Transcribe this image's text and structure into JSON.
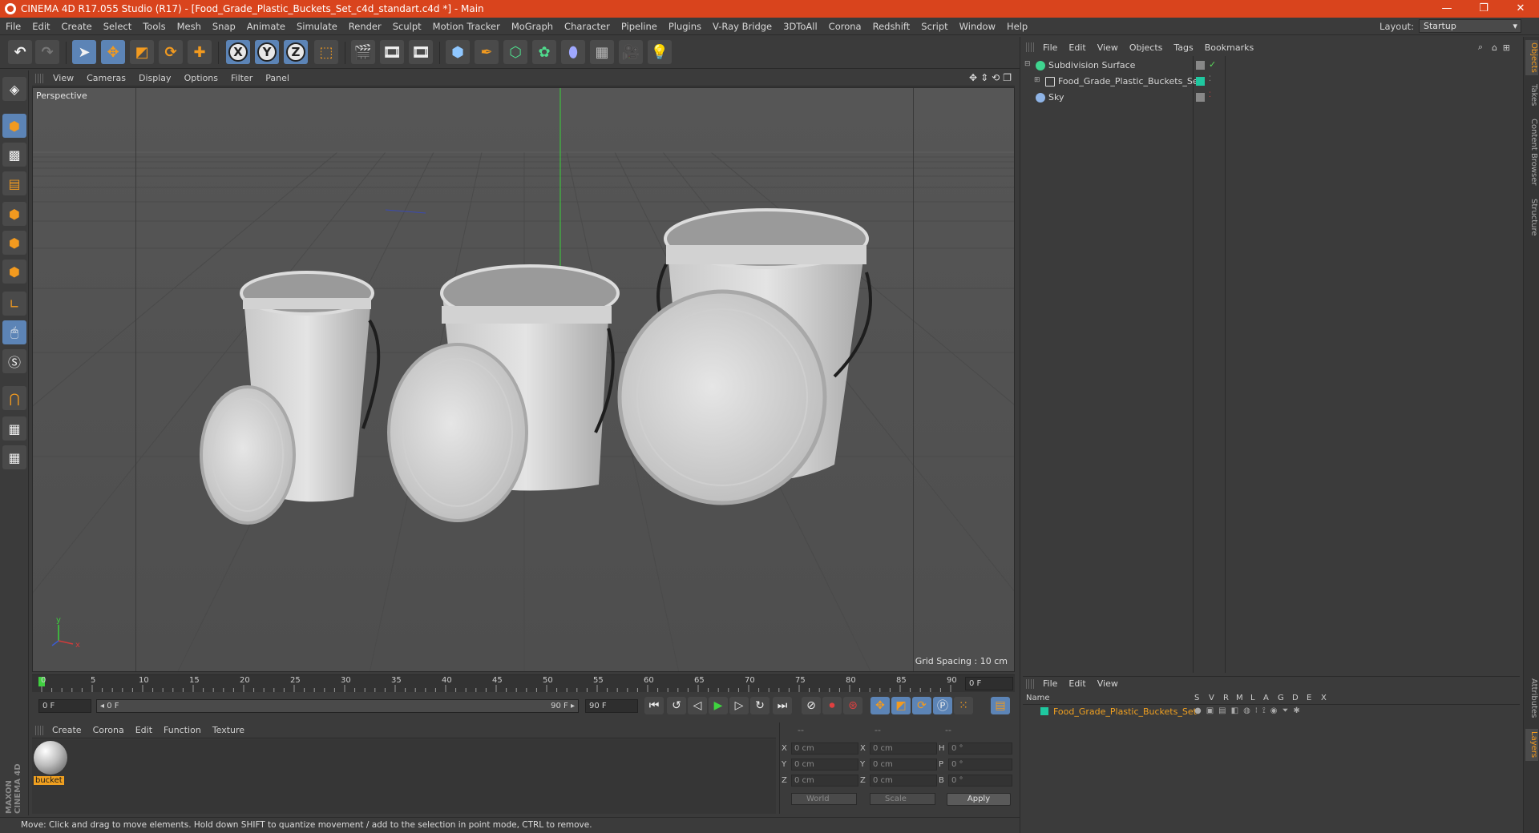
{
  "window": {
    "title": "CINEMA 4D R17.055 Studio (R17) - [Food_Grade_Plastic_Buckets_Set_c4d_standart.c4d *] - Main",
    "controls": [
      "—",
      "❐",
      "✕"
    ]
  },
  "menu": [
    "File",
    "Edit",
    "Create",
    "Select",
    "Tools",
    "Mesh",
    "Snap",
    "Animate",
    "Simulate",
    "Render",
    "Sculpt",
    "Motion Tracker",
    "MoGraph",
    "Character",
    "Pipeline",
    "Plugins",
    "V-Ray Bridge",
    "3DToAll",
    "Corona",
    "Redshift",
    "Script",
    "Window",
    "Help"
  ],
  "layout": {
    "label": "Layout:",
    "value": "Startup"
  },
  "toolbar": {
    "axis_x": "X",
    "axis_y": "Y",
    "axis_z": "Z"
  },
  "viewport": {
    "menu": [
      "View",
      "Cameras",
      "Display",
      "Options",
      "Filter",
      "Panel"
    ],
    "label": "Perspective",
    "grid_spacing": "Grid Spacing : 10 cm",
    "axis_y": "y",
    "axis_x": "x"
  },
  "timeline": {
    "ticks": [
      "0",
      "5",
      "10",
      "15",
      "20",
      "25",
      "30",
      "35",
      "40",
      "45",
      "50",
      "55",
      "60",
      "65",
      "70",
      "75",
      "80",
      "85",
      "90"
    ],
    "current_frame": "0 F",
    "start_frame": "0 F",
    "range_start": "◂ 0 F",
    "range_end": "90 F ▸",
    "end_frame": "90 F"
  },
  "material_manager": {
    "menu": [
      "Create",
      "Corona",
      "Edit",
      "Function",
      "Texture"
    ],
    "material_name": "bucket"
  },
  "coordinates": {
    "headers": [
      "--",
      "--",
      "--"
    ],
    "rows": [
      {
        "l1": "X",
        "v1": "0 cm",
        "l2": "X",
        "v2": "0 cm",
        "l3": "H",
        "v3": "0 °"
      },
      {
        "l1": "Y",
        "v1": "0 cm",
        "l2": "Y",
        "v2": "0 cm",
        "l3": "P",
        "v3": "0 °"
      },
      {
        "l1": "Z",
        "v1": "0 cm",
        "l2": "Z",
        "v2": "0 cm",
        "l3": "B",
        "v3": "0 °"
      }
    ],
    "mode": "World",
    "scale_mode": "Scale",
    "apply": "Apply"
  },
  "object_manager": {
    "menu": [
      "File",
      "Edit",
      "View",
      "Objects",
      "Tags",
      "Bookmarks"
    ],
    "objects": [
      {
        "name": "Subdivision Surface",
        "icon_color": "#3fd48f"
      },
      {
        "name": "Food_Grade_Plastic_Buckets_Set",
        "icon_color": "#cfcfcf",
        "tag_color": "#1fc8a0"
      },
      {
        "name": "Sky",
        "icon_color": "#8fb4e6"
      }
    ]
  },
  "layer_manager": {
    "menu": [
      "File",
      "Edit",
      "View"
    ],
    "columns": [
      "Name",
      "S",
      "V",
      "R",
      "M",
      "L",
      "A",
      "G",
      "D",
      "E",
      "X"
    ],
    "layers": [
      {
        "name": "Food_Grade_Plastic_Buckets_Set",
        "color": "#1fc8a0"
      }
    ]
  },
  "side_tabs": [
    "Objects",
    "Takes",
    "Content Browser",
    "Structure"
  ],
  "side_tabs_lower": [
    "Attributes",
    "Layers"
  ],
  "brand": "MAXON CINEMA 4D",
  "status": "Move: Click and drag to move elements. Hold down SHIFT to quantize movement / add to the selection in point mode, CTRL to remove."
}
